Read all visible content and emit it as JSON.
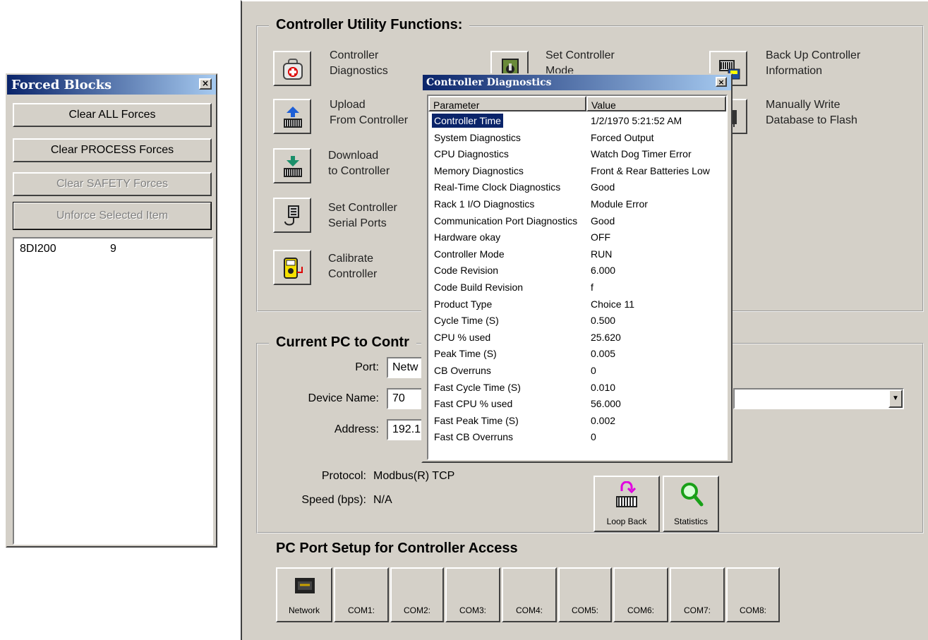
{
  "forced_blocks": {
    "title": "Forced Blocks",
    "buttons": {
      "clear_all": "Clear ALL Forces",
      "clear_process": "Clear PROCESS Forces",
      "clear_safety": "Clear SAFETY Forces",
      "unforce": "Unforce Selected Item"
    },
    "items": [
      {
        "name": "8DI200",
        "value": "9"
      }
    ]
  },
  "main": {
    "utility_title": "Controller Utility Functions:",
    "functions": {
      "diagnostics": {
        "line1": "Controller",
        "line2": "Diagnostics"
      },
      "set_mode": {
        "line1": "Set Controller",
        "line2": "Mode"
      },
      "backup": {
        "line1": "Back Up Controller",
        "line2": "Information"
      },
      "upload": {
        "line1": "Upload",
        "line2": "From Controller"
      },
      "write_flash": {
        "line1": "Manually Write",
        "line2": "Database to Flash"
      },
      "download": {
        "line1": "Download",
        "line2": "to Controller"
      },
      "serial_ports": {
        "line1": "Set Controller",
        "line2": "Serial Ports"
      },
      "calibrate": {
        "line1": "Calibrate",
        "line2": "Controller"
      }
    },
    "connection_title": "Current PC to Contr",
    "port_label": "Port:",
    "port_value": "Netw",
    "device_label": "Device Name:",
    "device_value": "70",
    "address_label": "Address:",
    "address_value": "192.1",
    "protocol_label": "Protocol:",
    "protocol_value": "Modbus(R) TCP",
    "speed_label": "Speed (bps):",
    "speed_value": "N/A",
    "loopback_label": "Loop Back",
    "statistics_label": "Statistics",
    "port_setup_title": "PC Port Setup for Controller Access",
    "ports": [
      "Network",
      "COM1:",
      "COM2:",
      "COM3:",
      "COM4:",
      "COM5:",
      "COM6:",
      "COM7:",
      "COM8:"
    ]
  },
  "diagnostics": {
    "title": "Controller Diagnostics",
    "col_parameter": "Parameter",
    "col_value": "Value",
    "rows": [
      {
        "p": "Controller Time",
        "v": "1/2/1970 5:21:52 AM"
      },
      {
        "p": "System Diagnostics",
        "v": "Forced Output"
      },
      {
        "p": "CPU Diagnostics",
        "v": "Watch Dog Timer Error"
      },
      {
        "p": "Memory Diagnostics",
        "v": "Front & Rear Batteries Low"
      },
      {
        "p": "Real-Time Clock Diagnostics",
        "v": "Good"
      },
      {
        "p": "Rack 1 I/O Diagnostics",
        "v": "Module Error"
      },
      {
        "p": "Communication Port Diagnostics",
        "v": "Good"
      },
      {
        "p": "Hardware okay",
        "v": "OFF"
      },
      {
        "p": "Controller Mode",
        "v": "RUN"
      },
      {
        "p": "Code Revision",
        "v": "6.000"
      },
      {
        "p": "Code Build Revision",
        "v": "f"
      },
      {
        "p": "Product Type",
        "v": "Choice 11"
      },
      {
        "p": "Cycle Time (S)",
        "v": "0.500"
      },
      {
        "p": "CPU % used",
        "v": "25.620"
      },
      {
        "p": "Peak Time (S)",
        "v": "0.005"
      },
      {
        "p": "CB Overruns",
        "v": "0"
      },
      {
        "p": "Fast Cycle Time (S)",
        "v": "0.010"
      },
      {
        "p": "Fast CPU % used",
        "v": "56.000"
      },
      {
        "p": "Fast Peak Time (S)",
        "v": "0.002"
      },
      {
        "p": "Fast CB Overruns",
        "v": "0"
      }
    ]
  }
}
